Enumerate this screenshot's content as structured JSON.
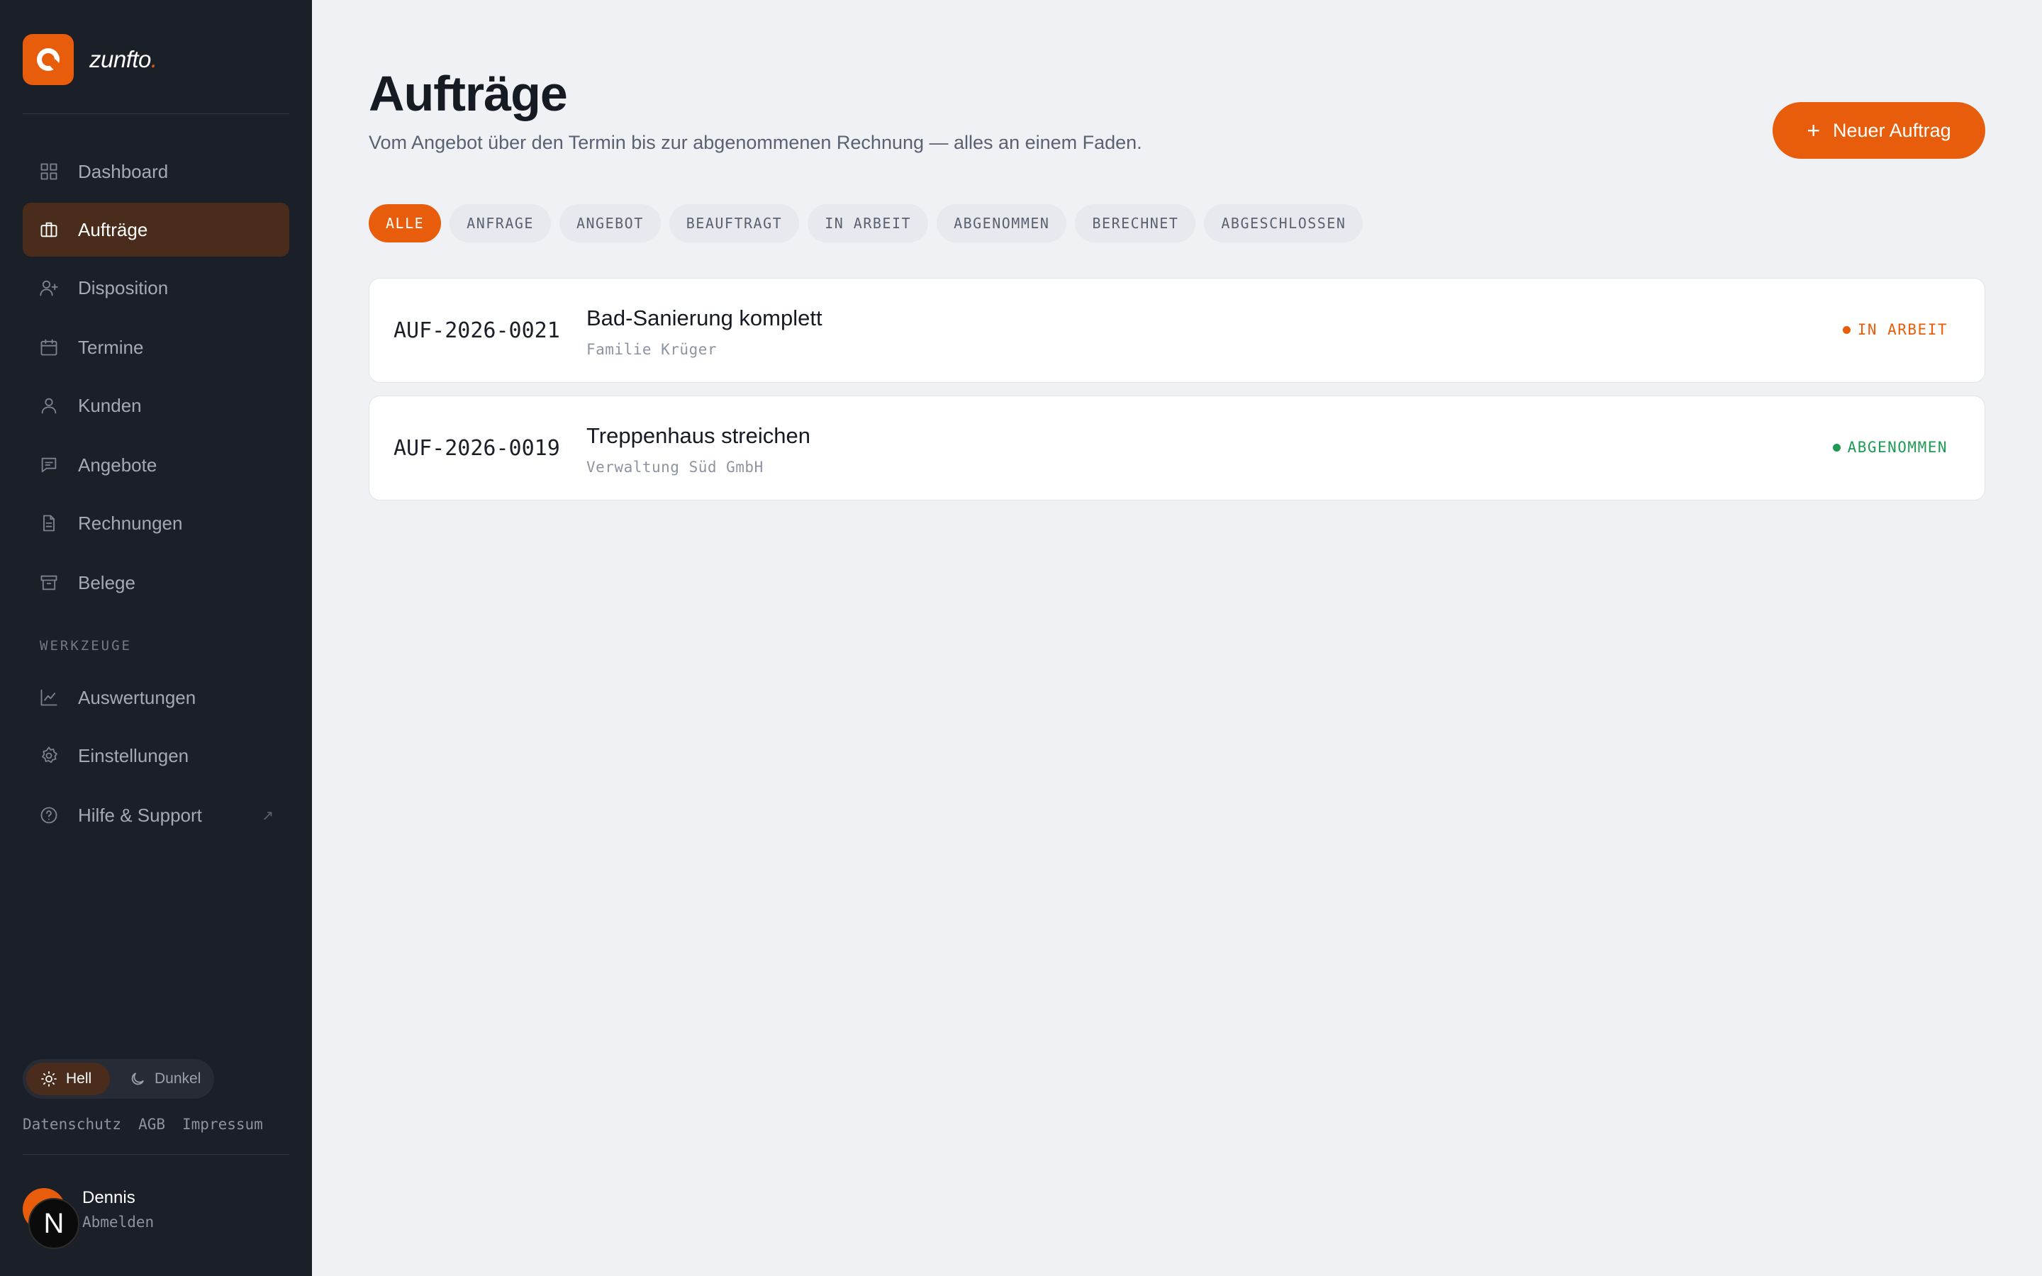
{
  "brand": {
    "name": "zunfto",
    "suffix": ".",
    "accent_color": "#e85d0c"
  },
  "sidebar": {
    "nav": [
      {
        "label": "Dashboard",
        "icon": "grid-icon"
      },
      {
        "label": "Aufträge",
        "icon": "briefcase-icon",
        "active": true
      },
      {
        "label": "Disposition",
        "icon": "user-plus-icon"
      },
      {
        "label": "Termine",
        "icon": "calendar-icon"
      },
      {
        "label": "Kunden",
        "icon": "user-icon"
      },
      {
        "label": "Angebote",
        "icon": "message-icon"
      },
      {
        "label": "Rechnungen",
        "icon": "document-icon"
      },
      {
        "label": "Belege",
        "icon": "archive-icon"
      }
    ],
    "tools_label": "WERKZEUGE",
    "tools": [
      {
        "label": "Auswertungen",
        "icon": "chart-icon"
      },
      {
        "label": "Einstellungen",
        "icon": "gear-icon"
      },
      {
        "label": "Hilfe & Support",
        "icon": "help-icon",
        "external_icon": "↗"
      }
    ],
    "theme": {
      "light": "Hell",
      "dark": "Dunkel",
      "selected": "Hell"
    },
    "legal": [
      "Datenschutz",
      "AGB",
      "Impressum"
    ],
    "user": {
      "name": "Dennis",
      "initial": "N",
      "logout": "Abmelden"
    }
  },
  "main": {
    "title": "Aufträge",
    "subtitle": "Vom Angebot über den Termin bis zur abgenommenen Rechnung — alles an einem Faden.",
    "new_button": {
      "icon": "+",
      "label": "Neuer Auftrag"
    },
    "filters": [
      "ALLE",
      "ANFRAGE",
      "ANGEBOT",
      "BEAUFTRAGT",
      "IN ARBEIT",
      "ABGENOMMEN",
      "BERECHNET",
      "ABGESCHLOSSEN"
    ],
    "active_filter": "ALLE",
    "orders": [
      {
        "ref": "AUF-2026-0021",
        "title": "Bad-Sanierung komplett",
        "client": "Familie Krüger",
        "status": "IN ARBEIT",
        "status_color": "#e85d0c"
      },
      {
        "ref": "AUF-2026-0019",
        "title": "Treppenhaus streichen",
        "client": "Verwaltung Süd GmbH",
        "status": "ABGENOMMEN",
        "status_color": "#1f9a55"
      }
    ]
  }
}
